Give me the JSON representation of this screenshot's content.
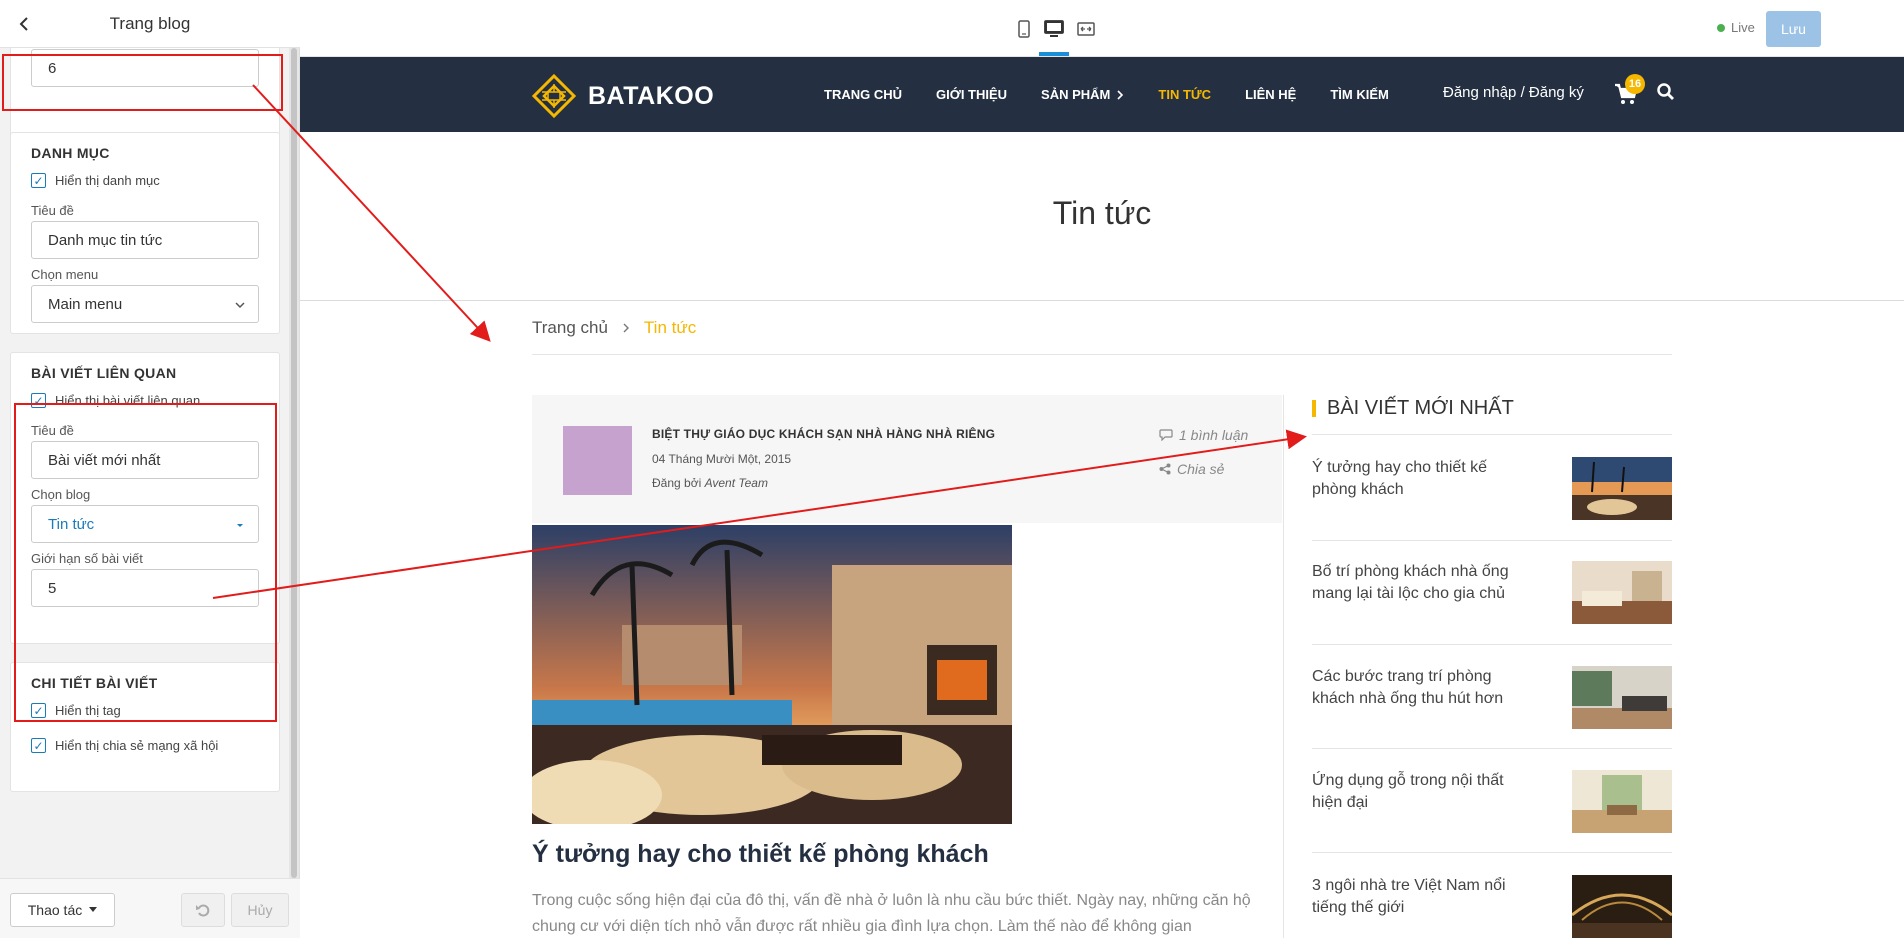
{
  "panel": {
    "title": "Trang blog",
    "top_input_value": "6",
    "category": {
      "title": "DANH MỤC",
      "show_label": "Hiển thị danh mục",
      "title_label": "Tiêu đề",
      "title_value": "Danh mục tin tức",
      "menu_label": "Chọn menu",
      "menu_value": "Main menu"
    },
    "related": {
      "title": "BÀI VIẾT LIÊN QUAN",
      "show_label": "Hiển thị bài viết liên quan",
      "title_label": "Tiêu đề",
      "title_value": "Bài viết mới nhất",
      "blog_label": "Chọn blog",
      "blog_value": "Tin tức",
      "limit_label": "Giới hạn số bài viết",
      "limit_value": "5"
    },
    "detail": {
      "title": "CHI TIẾT BÀI VIẾT",
      "tag_label": "Hiển thị tag",
      "share_label": "Hiển thị chia sẻ mạng xã hội"
    },
    "footer": {
      "actions_label": "Thao tác",
      "cancel_label": "Hủy"
    }
  },
  "toolbar": {
    "live_label": "Live",
    "save_label": "Lưu",
    "accent_color": "#1a8fd8"
  },
  "site": {
    "logo_text": "BATAKOO",
    "menu": [
      "TRANG CHỦ",
      "GIỚI THIỆU",
      "SẢN PHẨM",
      "TIN TỨC",
      "LIÊN HỆ",
      "TÌM KIẾM"
    ],
    "login": "Đăng nhập / Đăng ký",
    "cart_count": "16",
    "brand_color": "#f5b700",
    "nav_bg": "#243042"
  },
  "page": {
    "title": "Tin tức",
    "breadcrumb_home": "Trang chủ",
    "breadcrumb_current": "Tin tức"
  },
  "post": {
    "category": "BIỆT THỰ GIÁO DỤC KHÁCH SẠN NHÀ HÀNG NHÀ RIÊNG",
    "date": "04 Tháng Mười Một, 2015",
    "author_prefix": "Đăng bởi",
    "author": "Avent Team",
    "comments": "1 bình luận",
    "share": "Chia sẻ",
    "title": "Ý tưởng hay cho thiết kế phòng khách",
    "excerpt": "Trong cuộc sống hiện đại của đô thị, vấn đề nhà ở luôn là nhu cầu bức thiết. Ngày nay, những căn hộ chung cư với diện tích nhỏ vẫn được rất nhiều gia đình lựa chọn. Làm thế nào để không gian"
  },
  "sidebar": {
    "title": "BÀI VIẾT MỚI NHẤT",
    "items": [
      "Ý tưởng hay cho thiết kế phòng khách",
      "Bố trí phòng khách nhà ống mang lại tài lộc cho gia chủ",
      "Các bước trang trí phòng khách nhà ống thu hút hơn",
      "Ứng dụng gỗ trong nội thất hiện đại",
      "3 ngôi nhà tre Việt Nam nổi tiếng thế giới"
    ]
  }
}
